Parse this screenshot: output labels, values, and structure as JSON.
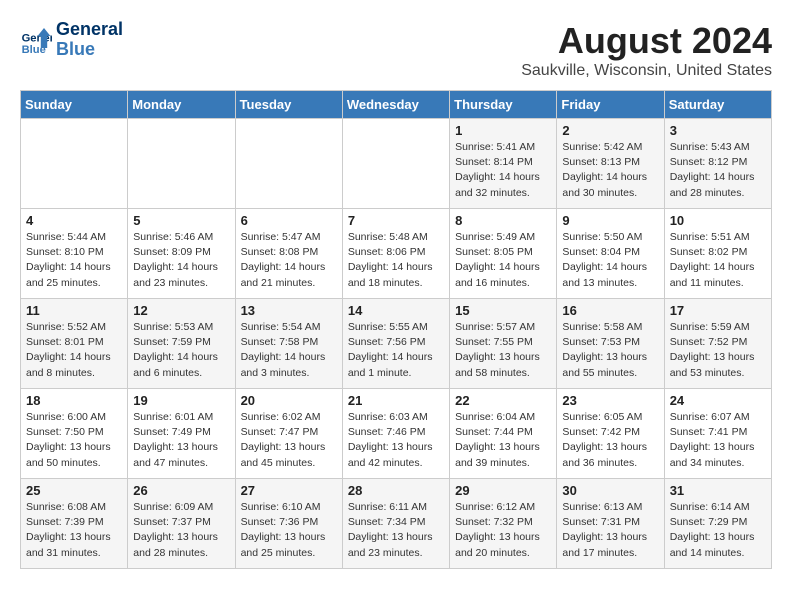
{
  "header": {
    "logo_line1": "General",
    "logo_line2": "Blue",
    "title": "August 2024",
    "subtitle": "Saukville, Wisconsin, United States"
  },
  "weekdays": [
    "Sunday",
    "Monday",
    "Tuesday",
    "Wednesday",
    "Thursday",
    "Friday",
    "Saturday"
  ],
  "weeks": [
    [
      {
        "day": "",
        "info": ""
      },
      {
        "day": "",
        "info": ""
      },
      {
        "day": "",
        "info": ""
      },
      {
        "day": "",
        "info": ""
      },
      {
        "day": "1",
        "info": "Sunrise: 5:41 AM\nSunset: 8:14 PM\nDaylight: 14 hours\nand 32 minutes."
      },
      {
        "day": "2",
        "info": "Sunrise: 5:42 AM\nSunset: 8:13 PM\nDaylight: 14 hours\nand 30 minutes."
      },
      {
        "day": "3",
        "info": "Sunrise: 5:43 AM\nSunset: 8:12 PM\nDaylight: 14 hours\nand 28 minutes."
      }
    ],
    [
      {
        "day": "4",
        "info": "Sunrise: 5:44 AM\nSunset: 8:10 PM\nDaylight: 14 hours\nand 25 minutes."
      },
      {
        "day": "5",
        "info": "Sunrise: 5:46 AM\nSunset: 8:09 PM\nDaylight: 14 hours\nand 23 minutes."
      },
      {
        "day": "6",
        "info": "Sunrise: 5:47 AM\nSunset: 8:08 PM\nDaylight: 14 hours\nand 21 minutes."
      },
      {
        "day": "7",
        "info": "Sunrise: 5:48 AM\nSunset: 8:06 PM\nDaylight: 14 hours\nand 18 minutes."
      },
      {
        "day": "8",
        "info": "Sunrise: 5:49 AM\nSunset: 8:05 PM\nDaylight: 14 hours\nand 16 minutes."
      },
      {
        "day": "9",
        "info": "Sunrise: 5:50 AM\nSunset: 8:04 PM\nDaylight: 14 hours\nand 13 minutes."
      },
      {
        "day": "10",
        "info": "Sunrise: 5:51 AM\nSunset: 8:02 PM\nDaylight: 14 hours\nand 11 minutes."
      }
    ],
    [
      {
        "day": "11",
        "info": "Sunrise: 5:52 AM\nSunset: 8:01 PM\nDaylight: 14 hours\nand 8 minutes."
      },
      {
        "day": "12",
        "info": "Sunrise: 5:53 AM\nSunset: 7:59 PM\nDaylight: 14 hours\nand 6 minutes."
      },
      {
        "day": "13",
        "info": "Sunrise: 5:54 AM\nSunset: 7:58 PM\nDaylight: 14 hours\nand 3 minutes."
      },
      {
        "day": "14",
        "info": "Sunrise: 5:55 AM\nSunset: 7:56 PM\nDaylight: 14 hours\nand 1 minute."
      },
      {
        "day": "15",
        "info": "Sunrise: 5:57 AM\nSunset: 7:55 PM\nDaylight: 13 hours\nand 58 minutes."
      },
      {
        "day": "16",
        "info": "Sunrise: 5:58 AM\nSunset: 7:53 PM\nDaylight: 13 hours\nand 55 minutes."
      },
      {
        "day": "17",
        "info": "Sunrise: 5:59 AM\nSunset: 7:52 PM\nDaylight: 13 hours\nand 53 minutes."
      }
    ],
    [
      {
        "day": "18",
        "info": "Sunrise: 6:00 AM\nSunset: 7:50 PM\nDaylight: 13 hours\nand 50 minutes."
      },
      {
        "day": "19",
        "info": "Sunrise: 6:01 AM\nSunset: 7:49 PM\nDaylight: 13 hours\nand 47 minutes."
      },
      {
        "day": "20",
        "info": "Sunrise: 6:02 AM\nSunset: 7:47 PM\nDaylight: 13 hours\nand 45 minutes."
      },
      {
        "day": "21",
        "info": "Sunrise: 6:03 AM\nSunset: 7:46 PM\nDaylight: 13 hours\nand 42 minutes."
      },
      {
        "day": "22",
        "info": "Sunrise: 6:04 AM\nSunset: 7:44 PM\nDaylight: 13 hours\nand 39 minutes."
      },
      {
        "day": "23",
        "info": "Sunrise: 6:05 AM\nSunset: 7:42 PM\nDaylight: 13 hours\nand 36 minutes."
      },
      {
        "day": "24",
        "info": "Sunrise: 6:07 AM\nSunset: 7:41 PM\nDaylight: 13 hours\nand 34 minutes."
      }
    ],
    [
      {
        "day": "25",
        "info": "Sunrise: 6:08 AM\nSunset: 7:39 PM\nDaylight: 13 hours\nand 31 minutes."
      },
      {
        "day": "26",
        "info": "Sunrise: 6:09 AM\nSunset: 7:37 PM\nDaylight: 13 hours\nand 28 minutes."
      },
      {
        "day": "27",
        "info": "Sunrise: 6:10 AM\nSunset: 7:36 PM\nDaylight: 13 hours\nand 25 minutes."
      },
      {
        "day": "28",
        "info": "Sunrise: 6:11 AM\nSunset: 7:34 PM\nDaylight: 13 hours\nand 23 minutes."
      },
      {
        "day": "29",
        "info": "Sunrise: 6:12 AM\nSunset: 7:32 PM\nDaylight: 13 hours\nand 20 minutes."
      },
      {
        "day": "30",
        "info": "Sunrise: 6:13 AM\nSunset: 7:31 PM\nDaylight: 13 hours\nand 17 minutes."
      },
      {
        "day": "31",
        "info": "Sunrise: 6:14 AM\nSunset: 7:29 PM\nDaylight: 13 hours\nand 14 minutes."
      }
    ]
  ]
}
